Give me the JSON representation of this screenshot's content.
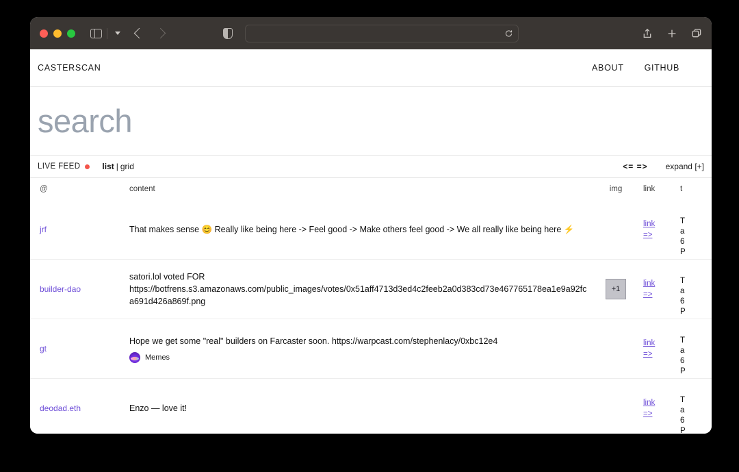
{
  "browser": {
    "address_value": "",
    "address_placeholder": "",
    "icons": {
      "sidebar": "sidebar-icon",
      "chevron_down": "chevron-down-icon",
      "back": "back-arrow-icon",
      "forward": "forward-arrow-icon",
      "shield": "privacy-shield-icon",
      "reload": "reload-icon",
      "share": "share-icon",
      "new_tab": "plus-icon",
      "tab_overview": "tab-overview-icon"
    }
  },
  "site": {
    "brand": "CASTERSCAN",
    "nav": [
      {
        "label": "ABOUT"
      },
      {
        "label": "GITHUB"
      }
    ]
  },
  "hero": {
    "search_placeholder": "search",
    "search_value": ""
  },
  "feedbar": {
    "live_feed_label": "LIVE FEED",
    "live_dot_color": "#f4544a",
    "modes": [
      {
        "label": "list",
        "active": true
      },
      {
        "label": "grid",
        "active": false
      }
    ],
    "mode_separator": "|",
    "prev_label": "<=",
    "next_label": "=>",
    "expand_label": "expand [+]"
  },
  "table": {
    "columns": {
      "at": "@",
      "content": "content",
      "img": "img",
      "link": "link",
      "time": "t"
    },
    "rows": [
      {
        "handle": "jrf",
        "content": "That makes sense 😊 Really like being here -> Feel good -> Make others feel good -> We all really like being here ⚡",
        "img": null,
        "link_label": "link",
        "arrow_label": "=>",
        "time_lines": [
          "T",
          "a",
          "6",
          "P"
        ]
      },
      {
        "handle": "builder-dao",
        "content": "satori.lol voted FOR\nhttps://botfrens.s3.amazonaws.com/public_images/votes/0x51aff4713d3ed4c2feeb2a0d383cd73e467765178ea1e9a92fca691d426a869f.png",
        "img": "+1",
        "link_label": "link",
        "arrow_label": "=>",
        "time_lines": [
          "T",
          "a",
          "6",
          "P"
        ]
      },
      {
        "handle": "gt",
        "content": "Hope we get some \"real\" builders on Farcaster soon. https://warpcast.com/stephenlacy/0xbc12e4",
        "channel": "Memes",
        "img": null,
        "link_label": "link",
        "arrow_label": "=>",
        "time_lines": [
          "T",
          "a",
          "6",
          "P"
        ]
      },
      {
        "handle": "deodad.eth",
        "content": "Enzo — love it!",
        "img": null,
        "link_label": "link",
        "arrow_label": "=>",
        "time_lines": [
          "T",
          "a",
          "6",
          "P"
        ]
      }
    ]
  },
  "colors": {
    "accent_link": "#6f4fd8",
    "toolbar_bg": "#3a3633",
    "placeholder": "#9aa3af"
  }
}
